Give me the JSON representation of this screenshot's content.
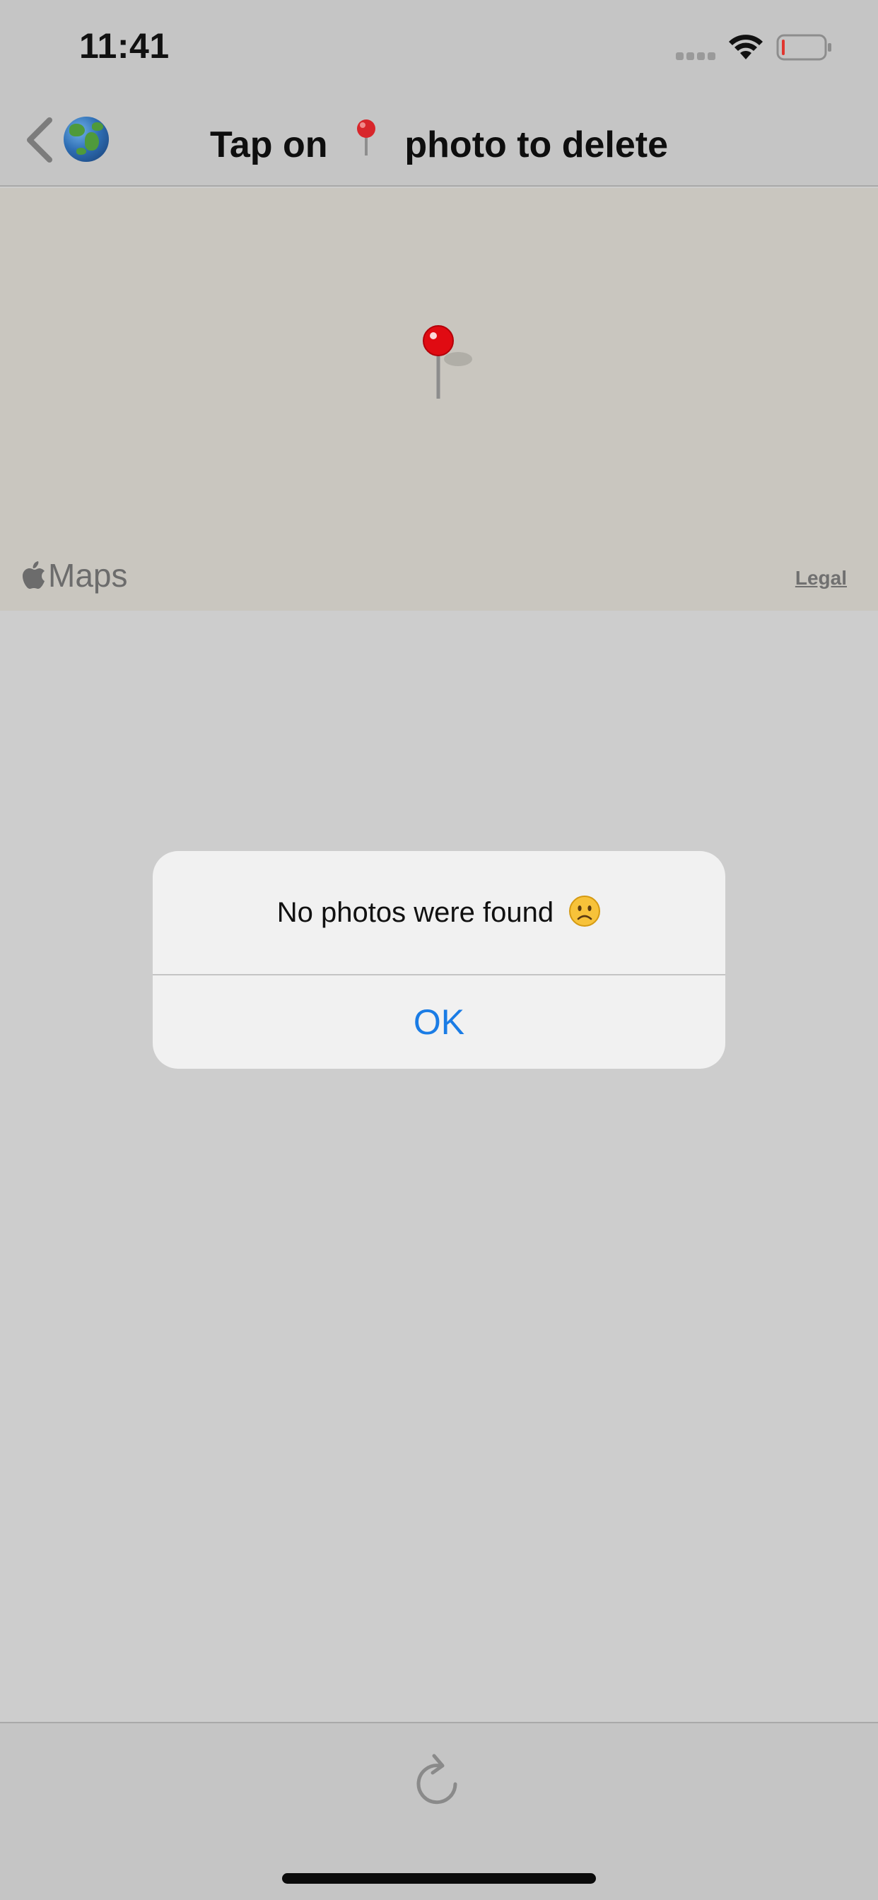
{
  "status_bar": {
    "time": "11:41"
  },
  "nav": {
    "back_icon": "chevron-left-icon",
    "globe_icon": "globe-asia-emoji",
    "title_prefix": "Tap on",
    "title_icon": "round-pushpin-emoji",
    "title_suffix": "photo to delete"
  },
  "map": {
    "pin_icon": "red-map-pin",
    "attribution": "Maps",
    "legal_label": "Legal"
  },
  "alert": {
    "message": "No photos were found",
    "message_icon": "frowning-face-emoji",
    "ok_label": "OK",
    "ok_color": "#1a7ce5"
  },
  "toolbar": {
    "refresh_icon": "refresh-icon"
  }
}
